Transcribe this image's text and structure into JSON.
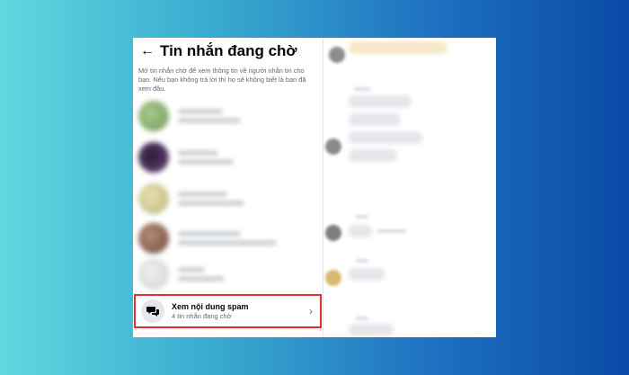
{
  "panel": {
    "back_glyph": "←",
    "title": "Tin nhắn đang chờ",
    "description": "Mở tin nhắn chờ để xem thông tin về người nhắn tin cho bạn. Nếu bạn không trả lời thì họ sẽ không biết là bạn đã xem đâu."
  },
  "spam": {
    "title": "Xem nội dung spam",
    "subtitle": "4 tin nhắn đang chờ",
    "icon": "chat-bubbles-icon",
    "chevron": "›"
  },
  "colors": {
    "highlight_border": "#e0312f",
    "background_gradient_start": "#5fd8df",
    "background_gradient_end": "#0a4aa6"
  }
}
